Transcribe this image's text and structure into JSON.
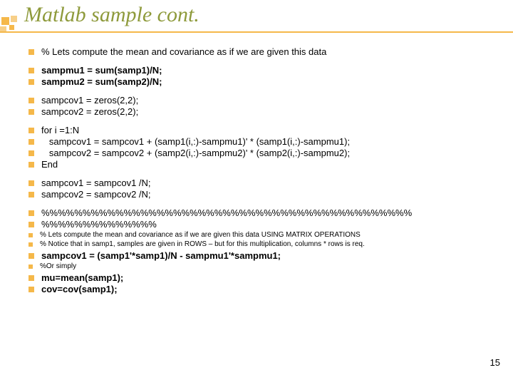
{
  "title": "Matlab sample cont.",
  "lines": [
    {
      "text": "% Lets compute the mean and covariance as if we are given this data",
      "bold": false,
      "small": false,
      "gapAfter": "gap"
    },
    {
      "text": "sampmu1 = sum(samp1)/N;",
      "bold": true,
      "small": false,
      "gapAfter": "none"
    },
    {
      "text": "sampmu2 = sum(samp2)/N;",
      "bold": true,
      "small": false,
      "gapAfter": "gap"
    },
    {
      "text": "sampcov1 = zeros(2,2);",
      "bold": false,
      "small": false,
      "gapAfter": "none"
    },
    {
      "text": "sampcov2 = zeros(2,2);",
      "bold": false,
      "small": false,
      "gapAfter": "gap"
    },
    {
      "text": "for i =1:N",
      "bold": false,
      "small": false,
      "gapAfter": "none"
    },
    {
      "text": "   sampcov1 = sampcov1 + (samp1(i,:)-sampmu1)' * (samp1(i,:)-sampmu1);",
      "bold": false,
      "small": false,
      "gapAfter": "none"
    },
    {
      "text": "   sampcov2 = sampcov2 + (samp2(i,:)-sampmu2)' * (samp2(i,:)-sampmu2);",
      "bold": false,
      "small": false,
      "gapAfter": "none"
    },
    {
      "text": "End",
      "bold": false,
      "small": false,
      "gapAfter": "gap"
    },
    {
      "text": "sampcov1 = sampcov1 /N;",
      "bold": false,
      "small": false,
      "gapAfter": "none"
    },
    {
      "text": "sampcov2 = sampcov2 /N;",
      "bold": false,
      "small": false,
      "gapAfter": "gap"
    },
    {
      "text": "%%%%%%%%%%%%%%%%%%%%%%%%%%%%%%%%%%%%%%%%%%%%%",
      "bold": false,
      "small": false,
      "gapAfter": "none"
    },
    {
      "text": "%%%%%%%%%%%%%%",
      "bold": false,
      "small": false,
      "gapAfter": "gap-s"
    },
    {
      "text": "% Lets compute the mean and covariance as if we are given this data USING MATRIX OPERATIONS",
      "bold": false,
      "small": true,
      "gapAfter": "none"
    },
    {
      "text": "% Notice that in samp1, samples are given in ROWS – but for this multiplication, columns * rows is req.",
      "bold": false,
      "small": true,
      "gapAfter": "gap-s"
    },
    {
      "text": "sampcov1 = (samp1'*samp1)/N - sampmu1'*sampmu1;",
      "bold": true,
      "small": false,
      "gapAfter": "gap-s"
    },
    {
      "text": "%Or simply",
      "bold": false,
      "small": true,
      "gapAfter": "gap-s"
    },
    {
      "text": "mu=mean(samp1);",
      "bold": true,
      "small": false,
      "gapAfter": "none"
    },
    {
      "text": "cov=cov(samp1);",
      "bold": true,
      "small": false,
      "gapAfter": "none"
    }
  ],
  "pageNumber": "15"
}
